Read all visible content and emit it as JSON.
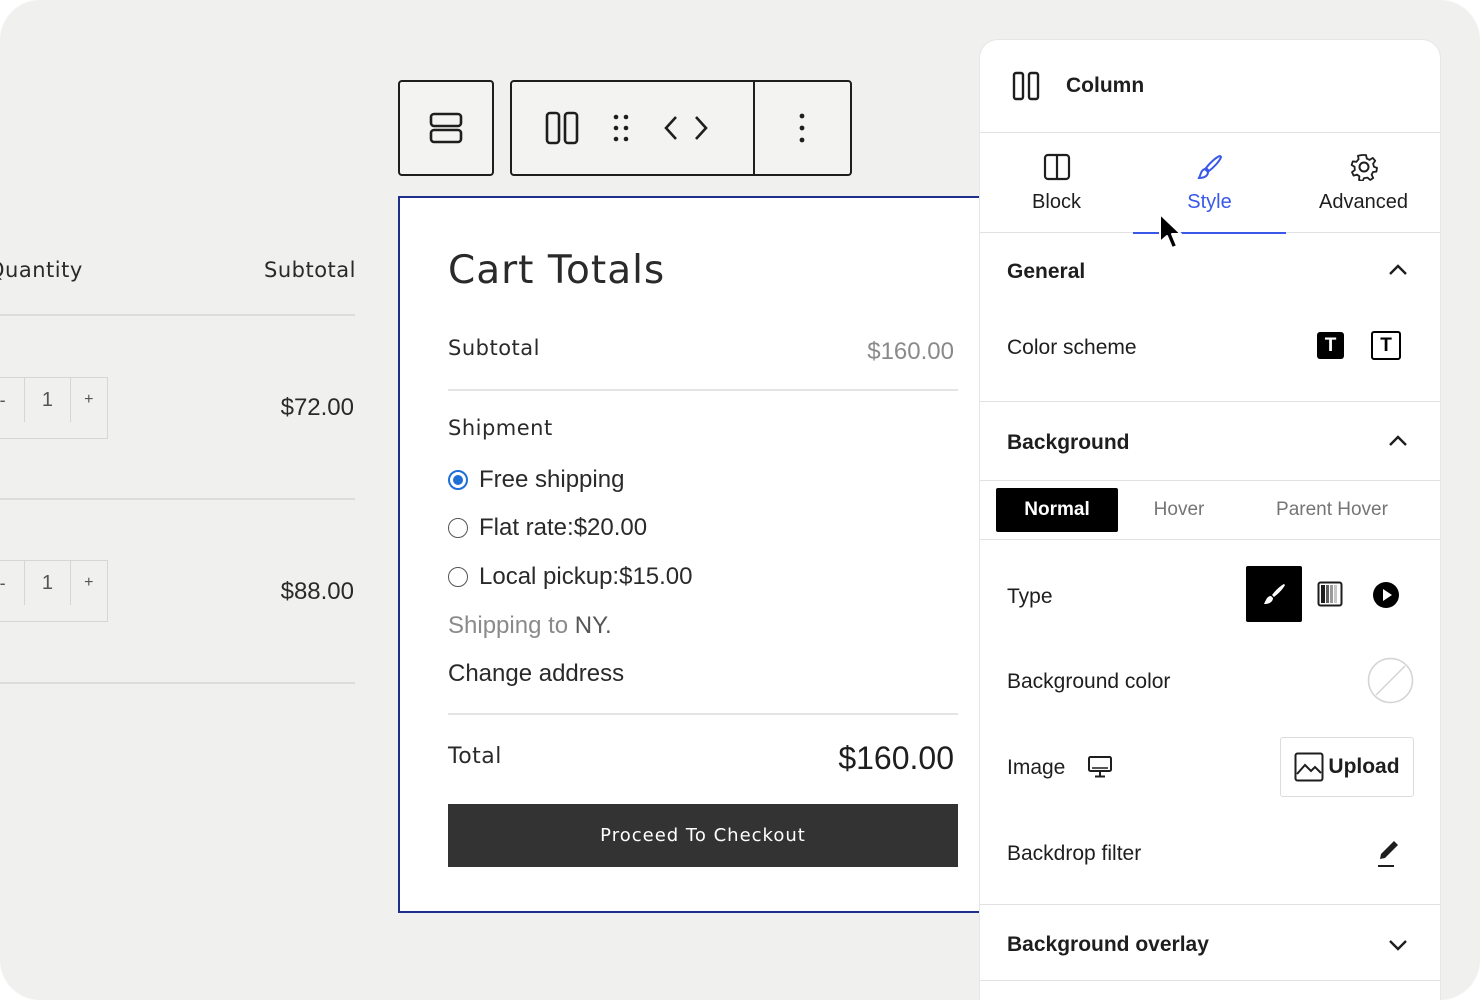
{
  "cart_table": {
    "header_quantity": "Quantity",
    "header_subtotal": "Subtotal",
    "rows": [
      {
        "minus": "-",
        "qty": "1",
        "plus": "+",
        "price": "$72.00"
      },
      {
        "minus": "-",
        "qty": "1",
        "plus": "+",
        "price": "$88.00"
      }
    ]
  },
  "toolbar": {
    "icons": [
      "stack-rows-icon",
      "columns-icon",
      "drag-handle-icon",
      "move-left-icon",
      "move-right-icon",
      "more-options-icon"
    ]
  },
  "cart_totals": {
    "title": "Cart Totals",
    "subtotal_label": "Subtotal",
    "subtotal_value": "$160.00",
    "shipment_label": "Shipment",
    "shipping_options": [
      {
        "text": "Free shipping",
        "price": "",
        "selected": true
      },
      {
        "text": "Flat rate: ",
        "price": "$20.00",
        "selected": false
      },
      {
        "text": "Local pickup: ",
        "price": "$15.00",
        "selected": false
      }
    ],
    "shipping_to_prefix": "Shipping to ",
    "shipping_to_state": "NY.",
    "change_address": "Change address",
    "total_label": "Total",
    "total_value": "$160.00",
    "checkout_button": "Proceed To Checkout"
  },
  "inspector": {
    "block_name": "Column",
    "tabs": [
      {
        "label": "Block",
        "icon": "layout-icon",
        "active": false
      },
      {
        "label": "Style",
        "icon": "brush-icon",
        "active": true
      },
      {
        "label": "Advanced",
        "icon": "gear-icon",
        "active": false
      }
    ],
    "general": {
      "title": "General",
      "color_scheme_label": "Color scheme",
      "scheme_glyph": "T"
    },
    "background": {
      "title": "Background",
      "state_tabs": [
        "Normal",
        "Hover",
        "Parent Hover"
      ],
      "active_state": "Normal",
      "type_label": "Type",
      "bg_color_label": "Background color",
      "image_label": "Image",
      "upload_label": "Upload",
      "backdrop_label": "Backdrop filter"
    },
    "overlay": {
      "title": "Background overlay"
    },
    "accent_color": "#3858e9"
  }
}
